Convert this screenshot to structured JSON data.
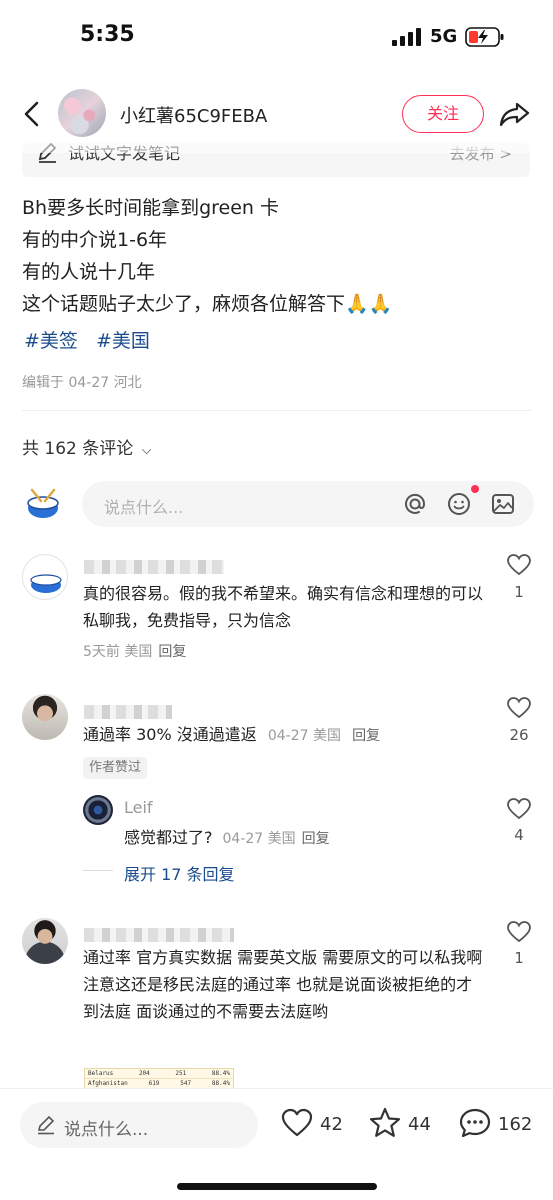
{
  "status_bar": {
    "time": "5:35",
    "network": "5G"
  },
  "header": {
    "username": "小红薯65C9FEBA",
    "follow_label": "关注"
  },
  "sticky_bar": {
    "text": "试试文字发笔记",
    "action": "去发布 >"
  },
  "post": {
    "lines": [
      "Bh要多长时间能拿到green 卡",
      "有的中介说1-6年",
      "有的人说十几年",
      "这个话题贴子太少了，麻烦各位解答下🙏🙏"
    ],
    "tags": [
      "#美签",
      "#美国"
    ],
    "edit_meta": "编辑于 04-27 河北"
  },
  "comments_header": {
    "label": "共 162 条评论"
  },
  "comment_input": {
    "placeholder": "说点什么..."
  },
  "comments": [
    {
      "text": "真的很容易。假的我不希望来。确实有信念和理想的可以私聊我，免费指导，只为信念",
      "meta": "5天前 美国",
      "reply_label": "回复",
      "likes": "1"
    },
    {
      "text": "通過率 30% 沒通過遣返",
      "meta": "04-27 美国",
      "reply_label": "回复",
      "likes": "26",
      "badge": "作者赞过",
      "sub_reply": {
        "name": "Leif",
        "text": "感觉都过了?",
        "meta": "04-27 美国",
        "reply_label": "回复",
        "likes": "4"
      },
      "expand_label": "展开 17 条回复"
    },
    {
      "text": "通过率 官方真实数据 需要英文版 需要原文的可以私我啊  注意这还是移民法庭的通过率 也就是说面谈被拒绝的才到法庭 面谈通过的不需要去法庭哟",
      "likes": "1",
      "table_rows": [
        [
          "Belarus",
          "204",
          "251",
          "88.4%"
        ],
        [
          "Afghanistan",
          "619",
          "547",
          "88.4%"
        ]
      ]
    }
  ],
  "bottom_bar": {
    "placeholder": "说点什么...",
    "likes": "42",
    "stars": "44",
    "comments": "162"
  }
}
